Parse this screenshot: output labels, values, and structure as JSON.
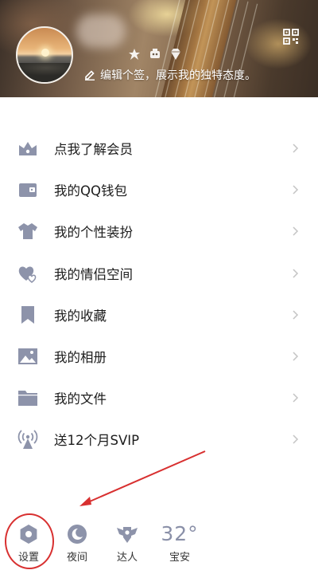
{
  "header": {
    "signature": "编辑个签，展示我的独特态度。"
  },
  "menu": {
    "items": [
      {
        "label": "点我了解会员",
        "icon": "crown-basket-icon"
      },
      {
        "label": "我的QQ钱包",
        "icon": "wallet-icon"
      },
      {
        "label": "我的个性装扮",
        "icon": "tshirt-icon"
      },
      {
        "label": "我的情侣空间",
        "icon": "hearts-icon"
      },
      {
        "label": "我的收藏",
        "icon": "bookmark-icon"
      },
      {
        "label": "我的相册",
        "icon": "photo-icon"
      },
      {
        "label": "我的文件",
        "icon": "folder-icon"
      },
      {
        "label": "送12个月SVIP",
        "icon": "broadcast-icon"
      }
    ]
  },
  "bottom_bar": {
    "settings": "设置",
    "night": "夜间",
    "master": "达人",
    "temperature": "32°",
    "city": "宝安"
  },
  "colors": {
    "icon": "#8d93aa",
    "annotation": "#d83030"
  }
}
